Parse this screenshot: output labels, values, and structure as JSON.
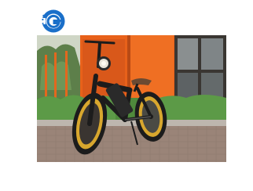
{
  "logo": {
    "icon": "g-circle-logo",
    "color": "#1a6fc9"
  },
  "photo": {
    "subject": "fat-tire-electric-bike-icon",
    "colors": {
      "wall_orange": "#e8611a",
      "frame_black": "#1c1c1c",
      "rim_gold": "#d8a72e",
      "hedge_green": "#4f8a3c",
      "pavement": "#9a8478"
    }
  }
}
